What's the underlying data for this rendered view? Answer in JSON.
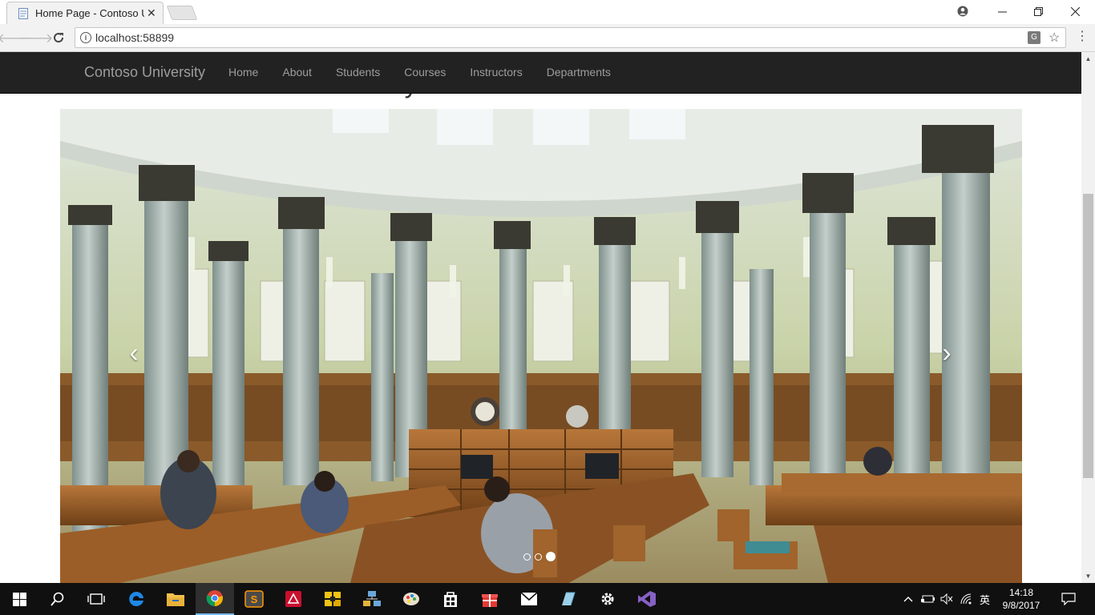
{
  "browser": {
    "tab_title": "Home Page - Contoso University",
    "url": "localhost:58899",
    "icons": {
      "account": "account-icon",
      "minimize": "minimize-icon",
      "maximize": "maximize-icon",
      "close": "close-icon",
      "back": "back-arrow-icon",
      "forward": "forward-arrow-icon",
      "reload": "reload-icon",
      "info": "info-icon",
      "translate": "translate-icon",
      "bookmark": "star-icon",
      "menu": "menu-icon"
    }
  },
  "page": {
    "heading": "Welcome to Contoso University",
    "navbar": {
      "brand": "Contoso University",
      "links": [
        "Home",
        "About",
        "Students",
        "Courses",
        "Instructors",
        "Departments"
      ]
    },
    "carousel": {
      "slide_description_icon": "library-rotunda-photo",
      "slide_count": 3,
      "active_slide": 3,
      "prev_icon": "chevron-left-icon",
      "next_icon": "chevron-right-icon"
    }
  },
  "taskbar": {
    "apps": [
      "start",
      "search",
      "task-view",
      "edge",
      "file-explorer",
      "chrome",
      "sublime-text",
      "acrobat",
      "app-yellow",
      "network-app",
      "paint",
      "store",
      "gift-app",
      "mail",
      "app-blue",
      "settings",
      "visual-studio"
    ],
    "tray": {
      "ime": "英"
    },
    "time": "14:18",
    "date": "9/8/2017"
  },
  "colors": {
    "navbar_bg": "#222222",
    "navbar_text": "#9d9d9d",
    "taskbar_bg": "#101010",
    "accent": "#76b9ed"
  }
}
